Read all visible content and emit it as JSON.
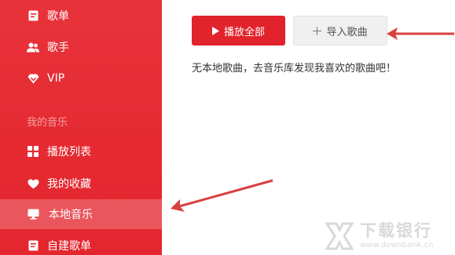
{
  "sidebar": {
    "items_top": [
      {
        "label": "歌单",
        "icon": "playlist-icon"
      },
      {
        "label": "歌手",
        "icon": "singer-icon"
      },
      {
        "label": "VIP",
        "icon": "vip-diamond-icon"
      }
    ],
    "section_title": "我的音乐",
    "items_my": [
      {
        "label": "播放列表",
        "icon": "grid-icon"
      },
      {
        "label": "我的收藏",
        "icon": "heart-icon"
      },
      {
        "label": "本地音乐",
        "icon": "monitor-icon",
        "active": true
      },
      {
        "label": "自建歌单",
        "icon": "document-icon"
      }
    ]
  },
  "main": {
    "play_all_label": "播放全部",
    "import_label": "导入歌曲",
    "empty_message": "无本地歌曲，去音乐库发现我喜欢的歌曲吧！"
  },
  "watermark": {
    "cn": "下载银行",
    "en": "www.downbank.cn"
  },
  "colors": {
    "sidebar_bg": "#e52a32",
    "play_button": "#e1232b",
    "annotation_arrow": "#d94040"
  }
}
